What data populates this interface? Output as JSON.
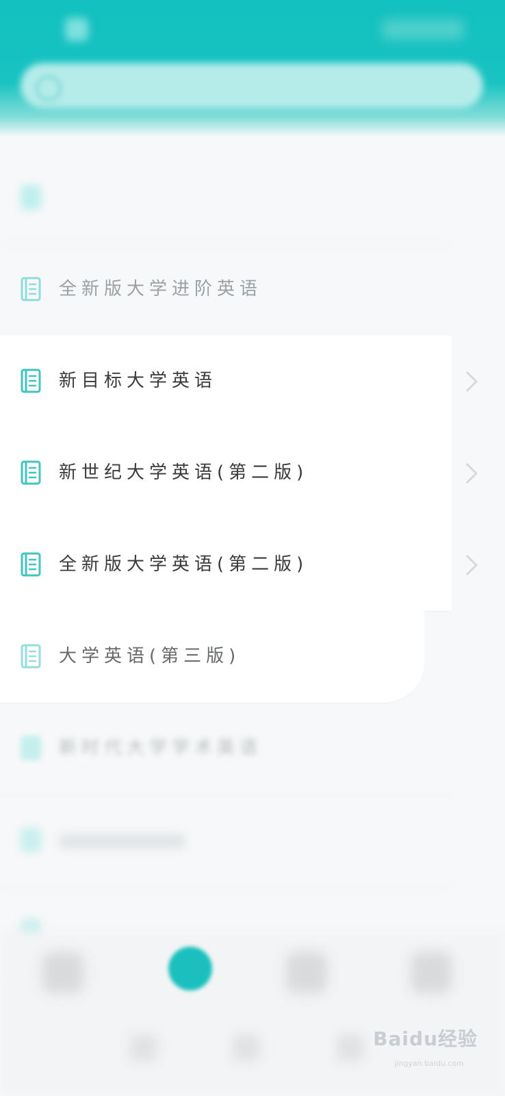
{
  "header": {
    "title": "",
    "search_placeholder": ""
  },
  "list": {
    "items": [
      {
        "label": "",
        "state": "blurred"
      },
      {
        "label": "全新版大学进阶英语",
        "state": "faded"
      },
      {
        "label": "新目标大学英语",
        "state": "normal"
      },
      {
        "label": "新世纪大学英语(第二版)",
        "state": "normal"
      },
      {
        "label": "全新版大学英语(第二版)",
        "state": "normal"
      },
      {
        "label": "大学英语(第三版)",
        "state": "faded"
      },
      {
        "label": "新时代大学学术英语",
        "state": "blurred"
      },
      {
        "label": "",
        "state": "blurred"
      },
      {
        "label": "",
        "state": "blurred"
      }
    ]
  },
  "watermark": {
    "text": "Baidu经验",
    "sub": "jingyan.baidu.com"
  },
  "colors": {
    "accent": "#13c1c0",
    "icon": "#3fc4c2",
    "text": "#3a3a3a",
    "chevron": "#d6d9db"
  }
}
